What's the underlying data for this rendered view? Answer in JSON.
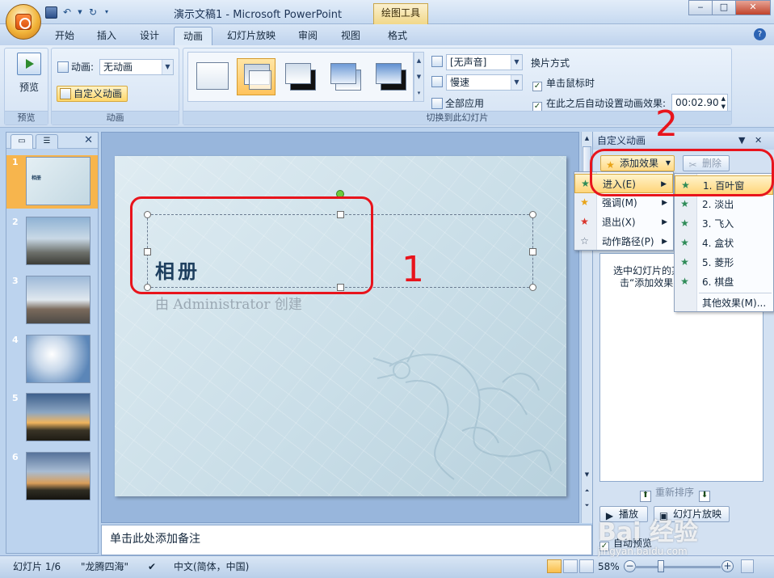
{
  "app": {
    "title": "演示文稿1 - Microsoft PowerPoint",
    "tool_tab": "绘图工具",
    "window_controls": [
      "‒",
      "□",
      "✕"
    ]
  },
  "tabs": [
    {
      "label": "开始",
      "active": false
    },
    {
      "label": "插入",
      "active": false
    },
    {
      "label": "设计",
      "active": false
    },
    {
      "label": "动画",
      "active": true
    },
    {
      "label": "幻灯片放映",
      "active": false
    },
    {
      "label": "审阅",
      "active": false
    },
    {
      "label": "视图",
      "active": false
    },
    {
      "label": "格式",
      "active": false
    }
  ],
  "ribbon": {
    "preview": {
      "button": "预览",
      "group": "预览"
    },
    "animation": {
      "label": "动画:",
      "value": "无动画",
      "custom_button": "自定义动画",
      "group": "动画"
    },
    "transition": {
      "sound": "[无声音]",
      "speed": "慢速",
      "apply_all": "全部应用",
      "mode_title": "换片方式",
      "on_click": "单击鼠标时",
      "auto_after": "在此之后自动设置动画效果:",
      "time": "00:02.90",
      "group": "切换到此幻灯片"
    }
  },
  "slides_pane": {
    "slides": [
      {
        "num": "1",
        "active": true,
        "thumb_title": "相册"
      },
      {
        "num": "2",
        "active": false
      },
      {
        "num": "3",
        "active": false
      },
      {
        "num": "4",
        "active": false
      },
      {
        "num": "5",
        "active": false
      },
      {
        "num": "6",
        "active": false
      }
    ]
  },
  "slide": {
    "title": "相册",
    "subtitle": "由 Administrator 创建"
  },
  "notes_placeholder": "单击此处添加备注",
  "task_pane": {
    "title": "自定义动画",
    "add_effect": "添加效果",
    "remove": "删除",
    "list_text_line1": "选中幻灯片的某",
    "list_text_line2": "击“添加效果",
    "reorder": "重新排序",
    "play": "播放",
    "slideshow": "幻灯片放映",
    "auto_preview": "自动预览"
  },
  "effect_menu": [
    {
      "label": "进入(E)",
      "color": "#2e8b57",
      "highlight": true
    },
    {
      "label": "强调(M)",
      "color": "#e8a317",
      "highlight": false
    },
    {
      "label": "退出(X)",
      "color": "#d9342b",
      "highlight": false
    },
    {
      "label": "动作路径(P)",
      "color": "#5b6b7f",
      "highlight": false
    }
  ],
  "entrance_menu": [
    {
      "label": "1. 百叶窗",
      "highlight": true
    },
    {
      "label": "2. 淡出",
      "highlight": false
    },
    {
      "label": "3. 飞入",
      "highlight": false
    },
    {
      "label": "4. 盒状",
      "highlight": false
    },
    {
      "label": "5. 菱形",
      "highlight": false
    },
    {
      "label": "6. 棋盘",
      "highlight": false
    },
    {
      "label": "其他效果(M)...",
      "highlight": false
    }
  ],
  "annotations": {
    "one": "1",
    "two": "2"
  },
  "status": {
    "slide_info": "幻灯片 1/6",
    "theme": "\"龙腾四海\"",
    "language": "中文(简体，中国)",
    "zoom": "58%"
  },
  "watermark": {
    "main": "Bai 经验",
    "sub": "jingyan.baidu.com"
  },
  "colors": {
    "accent": "#f7b54d",
    "annotation": "#e8141c",
    "ribbon": "#cfdff2"
  }
}
